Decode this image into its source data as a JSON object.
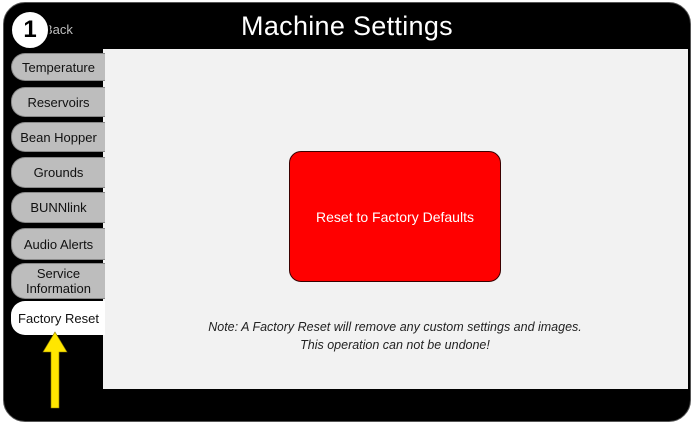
{
  "header": {
    "title": "Machine Settings",
    "back_label": "Back"
  },
  "step_badge": "1",
  "tabs": [
    {
      "label": "Temperature",
      "active": false
    },
    {
      "label": "Reservoirs",
      "active": false
    },
    {
      "label": "Bean Hopper",
      "active": false
    },
    {
      "label": "Grounds",
      "active": false
    },
    {
      "label": "BUNNlink",
      "active": false
    },
    {
      "label": "Audio Alerts",
      "active": false
    },
    {
      "label": "Service Information",
      "active": false
    },
    {
      "label": "Factory Reset",
      "active": true
    }
  ],
  "main": {
    "reset_button_label": "Reset to Factory Defaults",
    "note_line1": "Note: A Factory Reset will remove any custom settings and images.",
    "note_line2": "This operation can not be undone!"
  },
  "colors": {
    "reset_button": "#ff0000",
    "arrow": "#ffe600",
    "active_tab": "#ffffff",
    "inactive_tab": "#bdbdbd"
  },
  "icons": {
    "pointer": "up-arrow-icon"
  }
}
